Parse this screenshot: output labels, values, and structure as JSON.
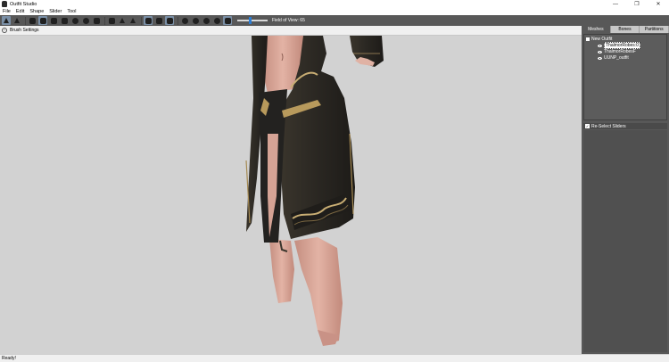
{
  "window": {
    "title": "Outfit Studio",
    "minimize": "—",
    "restore": "❐",
    "close": "✕"
  },
  "menu": {
    "items": [
      "File",
      "Edit",
      "Shape",
      "Slider",
      "Tool"
    ]
  },
  "toolbar": {
    "fov_label": "Field of View: 65",
    "fov_value": 65
  },
  "brush_settings": {
    "toggle_glyph": "−",
    "label": "Brush Settings"
  },
  "right_panel": {
    "tabs": [
      "Meshes",
      "Bones",
      "Partitions"
    ],
    "active_tab": "Meshes",
    "tree": {
      "root": "New Outfit",
      "items": [
        "ThalmorRobes:0",
        "ThalmorRobesF",
        "UUNP_outfit"
      ],
      "selected": "ThalmorRobes:0"
    },
    "reselect": {
      "checked": "✓",
      "label": "Re-Select Sliders"
    }
  },
  "status": {
    "text": "Ready!"
  },
  "colors": {
    "toolbar_bg": "#585858",
    "viewport_bg": "#d2d2d2",
    "accent": "#2d7dd2",
    "robe": "#2a2722",
    "trim": "#b89a5c",
    "skin": "#d9a79a"
  }
}
